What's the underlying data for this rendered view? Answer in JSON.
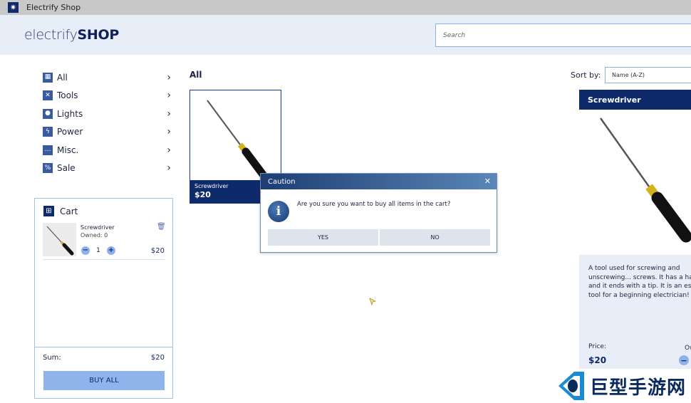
{
  "window": {
    "title": "Electrify Shop"
  },
  "header": {
    "logo_light": "electrify",
    "logo_bold": "SHOP",
    "search_placeholder": "Search"
  },
  "categories": [
    {
      "label": "All",
      "icon": "grid-icon"
    },
    {
      "label": "Tools",
      "icon": "tools-icon"
    },
    {
      "label": "Lights",
      "icon": "bulb-icon"
    },
    {
      "label": "Power",
      "icon": "lightning-icon"
    },
    {
      "label": "Misc.",
      "icon": "dots-icon"
    },
    {
      "label": "Sale",
      "icon": "percent-icon"
    }
  ],
  "cart": {
    "title": "Cart",
    "items": [
      {
        "name": "Screwdriver",
        "owned": "Owned: 0",
        "quantity": "1",
        "price": "$20"
      }
    ],
    "sum_label": "Sum:",
    "sum_value": "$20",
    "buy_all_label": "BUY ALL"
  },
  "main": {
    "section_title": "All",
    "sort_label": "Sort by:",
    "sort_value": "Name (A-Z)",
    "products": [
      {
        "name": "Screwdriver",
        "price": "$20"
      }
    ]
  },
  "detail": {
    "title": "Screwdriver",
    "description": "A tool used for screwing and\nunscrewing... screws. It has a han\nand it ends with a tip. It is an ess\ntool for a beginning electrician!",
    "price_label": "Price:",
    "price": "$20",
    "owned_label": "Ow"
  },
  "dialog": {
    "title": "Caution",
    "message": "Are you sure you want to buy all items in the cart?",
    "yes_label": "YES",
    "no_label": "NO"
  },
  "watermark": {
    "text": "巨型手游网"
  },
  "colors": {
    "navy": "#0f2a6b",
    "header_bg": "#e8eef8",
    "accent_light": "#8fb4ec",
    "border_blue": "#9ec0ea"
  }
}
